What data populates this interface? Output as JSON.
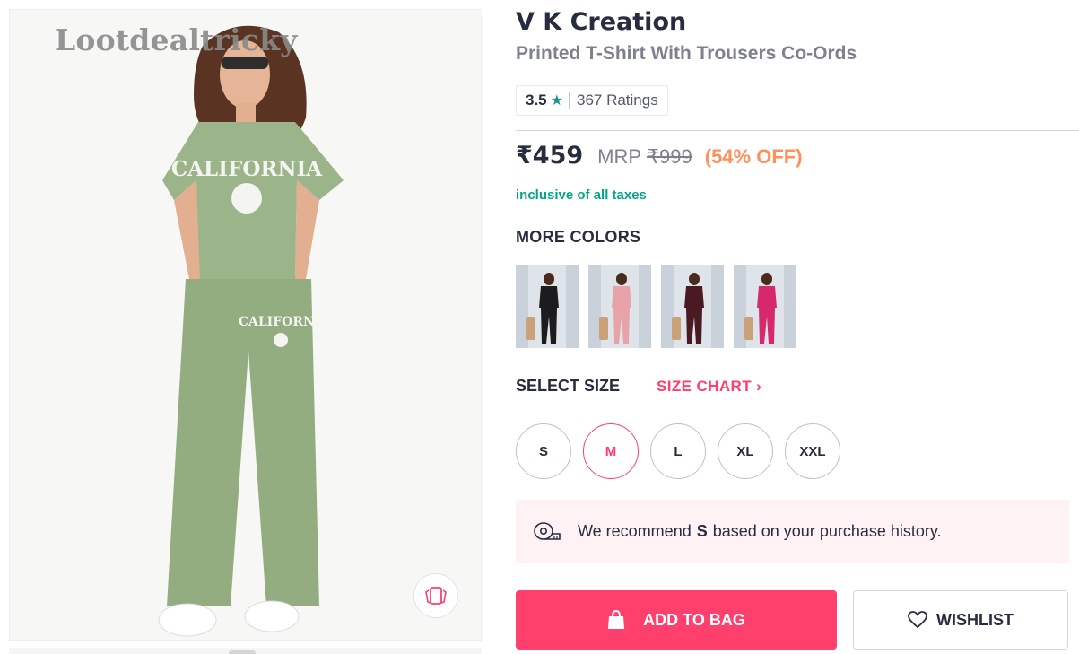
{
  "watermark": "Lootdealtricky",
  "product": {
    "brand": "V K Creation",
    "name": "Printed T-Shirt With Trousers Co-Ords",
    "rating": "3.5",
    "ratings_count": "367 Ratings",
    "price": "₹459",
    "mrp_label": "MRP",
    "mrp": "₹999",
    "discount": "(54% OFF)",
    "tax_note": "inclusive of all taxes"
  },
  "colors": {
    "title": "MORE COLORS",
    "swatches": [
      {
        "top": "#1c1c1e",
        "bottom": "#1c1c1e"
      },
      {
        "top": "#e7a3a8",
        "bottom": "#e7a3a8"
      },
      {
        "top": "#4a1a22",
        "bottom": "#4a1a22"
      },
      {
        "top": "#d6286a",
        "bottom": "#d6286a"
      }
    ]
  },
  "sizes": {
    "title": "SELECT SIZE",
    "chart_label": "SIZE CHART",
    "options": [
      "S",
      "M",
      "L",
      "XL",
      "XXL"
    ],
    "selected": "M"
  },
  "recommendation": {
    "prefix": "We recommend",
    "size": "S",
    "suffix": "based on your purchase history."
  },
  "actions": {
    "add_to_bag": "ADD TO BAG",
    "wishlist": "WISHLIST"
  },
  "theme": {
    "accent": "#ff3f6c",
    "discount": "#ff905a",
    "tax": "#03a685",
    "rating_star": "#14958f",
    "outfit": "#9bb489"
  }
}
